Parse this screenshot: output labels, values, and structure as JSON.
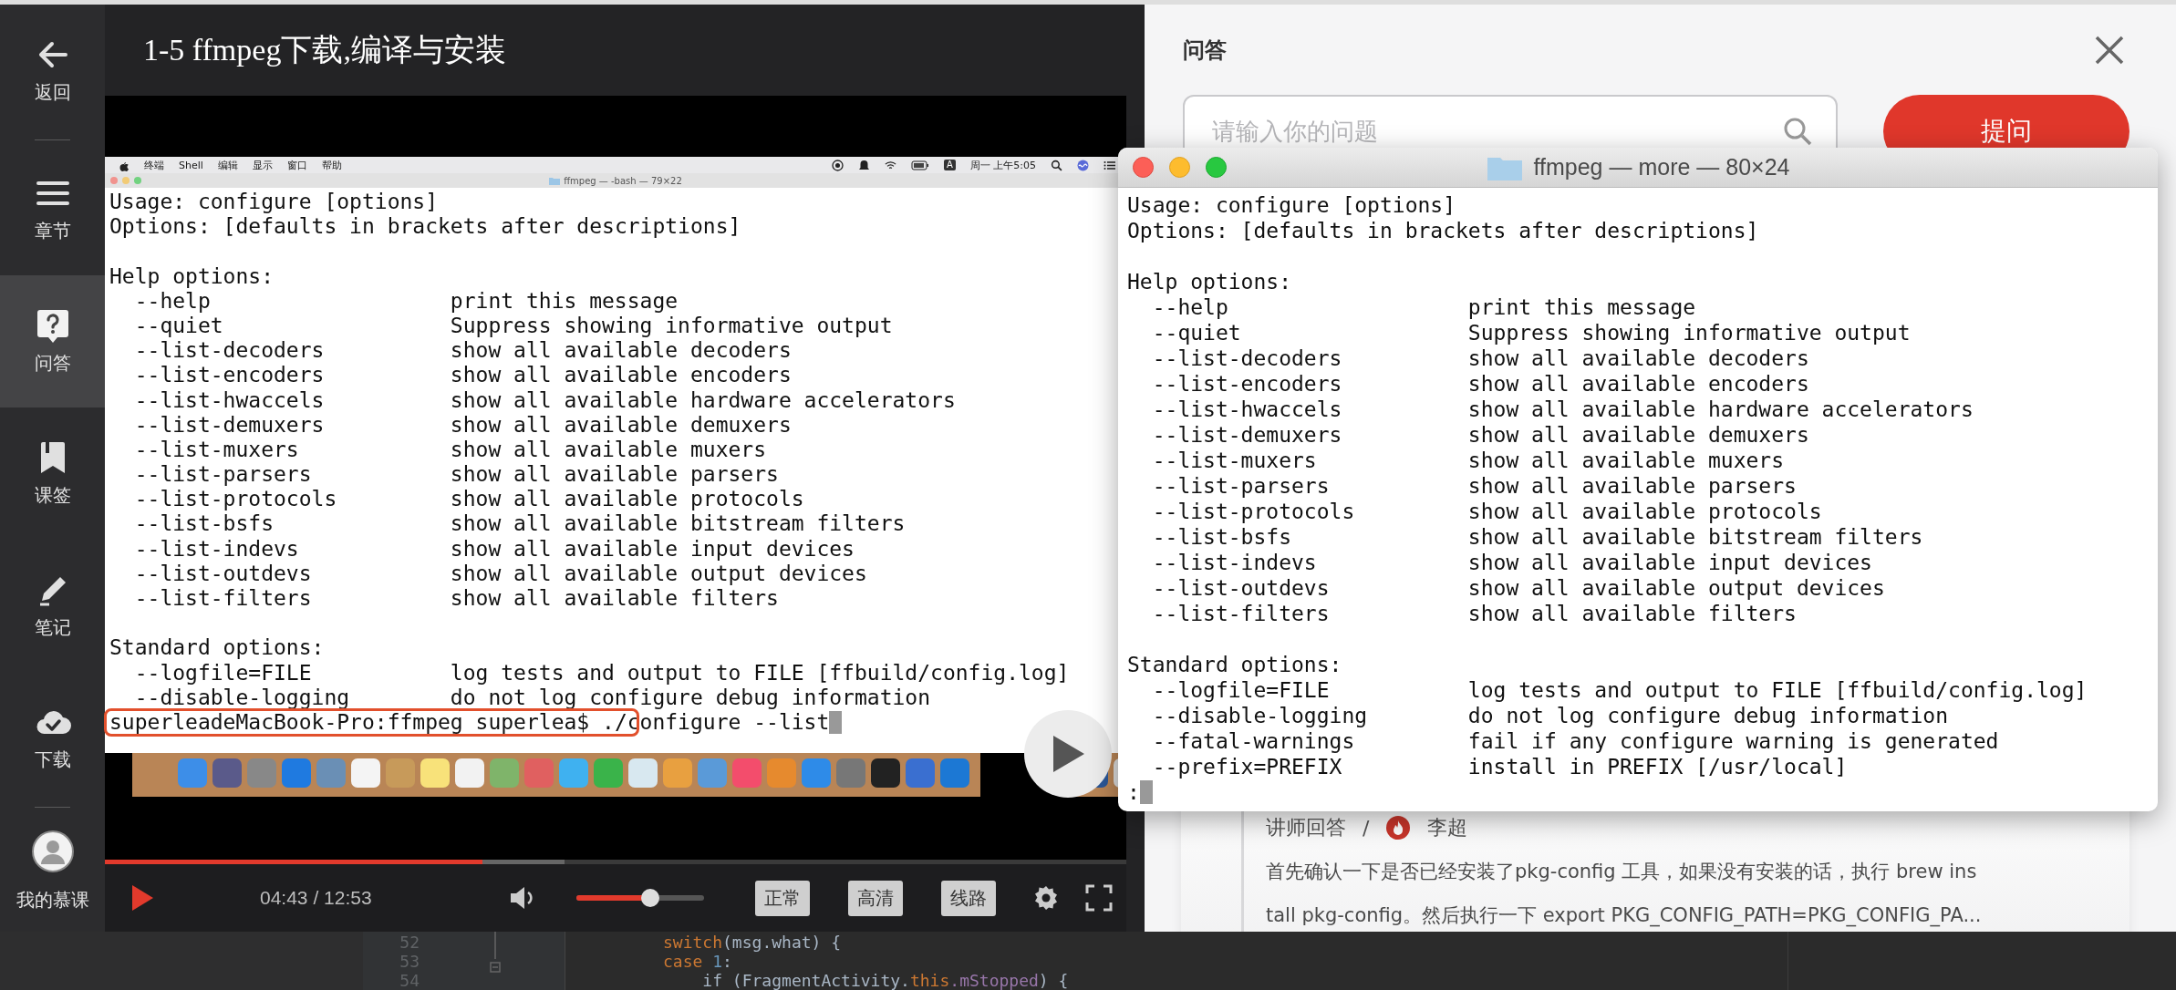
{
  "sidebar": {
    "items": [
      {
        "kind": "back",
        "label": "返回",
        "selected": false
      },
      {
        "kind": "chapters",
        "label": "章节",
        "selected": false
      },
      {
        "kind": "qa",
        "label": "问答",
        "selected": true
      },
      {
        "kind": "bookmark",
        "label": "课签",
        "selected": false
      },
      {
        "kind": "notes",
        "label": "笔记",
        "selected": false
      },
      {
        "kind": "download",
        "label": "下载",
        "selected": false
      }
    ],
    "profile": {
      "label": "我的慕课"
    }
  },
  "lesson_title": "1-5 ffmpeg下载,编译与安装",
  "video": {
    "menu_bar": {
      "items": [
        "终端",
        "Shell",
        "编辑",
        "显示",
        "窗口",
        "帮助"
      ],
      "input_source": "A",
      "clock": "周一 上午5:05"
    },
    "terminal": {
      "title": "ffmpeg — -bash — 79×22",
      "lines": [
        {
          "kind": "text",
          "text": "Usage: configure [options]"
        },
        {
          "kind": "text",
          "text": "Options: [defaults in brackets after descriptions]"
        },
        {
          "kind": "blank"
        },
        {
          "kind": "text",
          "text": "Help options:"
        },
        {
          "kind": "option",
          "option": "--help",
          "description": "print this message"
        },
        {
          "kind": "option",
          "option": "--quiet",
          "description": "Suppress showing informative output"
        },
        {
          "kind": "option",
          "option": "--list-decoders",
          "description": "show all available decoders"
        },
        {
          "kind": "option",
          "option": "--list-encoders",
          "description": "show all available encoders"
        },
        {
          "kind": "option",
          "option": "--list-hwaccels",
          "description": "show all available hardware accelerators"
        },
        {
          "kind": "option",
          "option": "--list-demuxers",
          "description": "show all available demuxers"
        },
        {
          "kind": "option",
          "option": "--list-muxers",
          "description": "show all available muxers"
        },
        {
          "kind": "option",
          "option": "--list-parsers",
          "description": "show all available parsers"
        },
        {
          "kind": "option",
          "option": "--list-protocols",
          "description": "show all available protocols"
        },
        {
          "kind": "option",
          "option": "--list-bsfs",
          "description": "show all available bitstream filters"
        },
        {
          "kind": "option",
          "option": "--list-indevs",
          "description": "show all available input devices"
        },
        {
          "kind": "option",
          "option": "--list-outdevs",
          "description": "show all available output devices"
        },
        {
          "kind": "option",
          "option": "--list-filters",
          "description": "show all available filters"
        },
        {
          "kind": "blank"
        },
        {
          "kind": "text",
          "text": "Standard options:"
        },
        {
          "kind": "option",
          "option": "--logfile=FILE",
          "description": "log tests and output to FILE [ffbuild/config.log]"
        },
        {
          "kind": "option",
          "option": "--disable-logging",
          "description": "do not log configure debug information"
        },
        {
          "kind": "prompt",
          "text": "superleadeMacBook-Pro:ffmpeg superlea$ ./configure --list",
          "highlighted": true
        }
      ]
    }
  },
  "player": {
    "progress": {
      "level": 0.37
    },
    "buffered": {
      "level": 0.45
    },
    "time": "04:43 / 12:53",
    "volume": {
      "level": 0.58
    },
    "buttons": [
      "正常",
      "高清",
      "线路"
    ]
  },
  "qa_panel": {
    "title": "问答",
    "search": {
      "placeholder": "请输入你的问题"
    },
    "ask_button": "提问",
    "answer": {
      "label": "讲师回答",
      "separator": "/",
      "author": "李超",
      "lines": [
        "首先确认一下是否已经安装了pkg-config 工具，如果没有安装的话，执行 brew ins",
        "tall pkg-config。然后执行一下 export PKG_CONFIG_PATH=PKG_CONFIG_PA..."
      ]
    }
  },
  "terminal_window": {
    "title": "ffmpeg — more — 80×24",
    "lines": [
      {
        "kind": "text",
        "text": "Usage: configure [options]"
      },
      {
        "kind": "text",
        "text": "Options: [defaults in brackets after descriptions]"
      },
      {
        "kind": "blank"
      },
      {
        "kind": "text",
        "text": "Help options:"
      },
      {
        "kind": "option",
        "option": "--help",
        "description": "print this message"
      },
      {
        "kind": "option",
        "option": "--quiet",
        "description": "Suppress showing informative output"
      },
      {
        "kind": "option",
        "option": "--list-decoders",
        "description": "show all available decoders"
      },
      {
        "kind": "option",
        "option": "--list-encoders",
        "description": "show all available encoders"
      },
      {
        "kind": "option",
        "option": "--list-hwaccels",
        "description": "show all available hardware accelerators"
      },
      {
        "kind": "option",
        "option": "--list-demuxers",
        "description": "show all available demuxers"
      },
      {
        "kind": "option",
        "option": "--list-muxers",
        "description": "show all available muxers"
      },
      {
        "kind": "option",
        "option": "--list-parsers",
        "description": "show all available parsers"
      },
      {
        "kind": "option",
        "option": "--list-protocols",
        "description": "show all available protocols"
      },
      {
        "kind": "option",
        "option": "--list-bsfs",
        "description": "show all available bitstream filters"
      },
      {
        "kind": "option",
        "option": "--list-indevs",
        "description": "show all available input devices"
      },
      {
        "kind": "option",
        "option": "--list-outdevs",
        "description": "show all available output devices"
      },
      {
        "kind": "option",
        "option": "--list-filters",
        "description": "show all available filters"
      },
      {
        "kind": "blank"
      },
      {
        "kind": "text",
        "text": "Standard options:"
      },
      {
        "kind": "option",
        "option": "--logfile=FILE",
        "description": "log tests and output to FILE [ffbuild/config.log]"
      },
      {
        "kind": "option",
        "option": "--disable-logging",
        "description": "do not log configure debug information"
      },
      {
        "kind": "option",
        "option": "--fatal-warnings",
        "description": "fail if any configure warning is generated"
      },
      {
        "kind": "option",
        "option": "--prefix=PREFIX",
        "description": "install in PREFIX [/usr/local]"
      },
      {
        "kind": "prompt",
        "text": ":",
        "highlighted": false
      }
    ]
  },
  "code_editor": {
    "lines": [
      {
        "number": "52",
        "tokens": [
          {
            "kind": "keyword",
            "text": "switch"
          },
          {
            "kind": "plain",
            "text": "(msg.what) {"
          }
        ]
      },
      {
        "number": "53",
        "tokens": [
          {
            "kind": "keyword",
            "text": "case "
          },
          {
            "kind": "number",
            "text": "1"
          },
          {
            "kind": "plain",
            "text": ":"
          }
        ]
      },
      {
        "number": "54",
        "tokens": [
          {
            "kind": "plain",
            "text": "    if (FragmentActivity."
          },
          {
            "kind": "keyword",
            "text": "this"
          },
          {
            "kind": "field",
            "text": ".mStopped"
          },
          {
            "kind": "plain",
            "text": ") {"
          }
        ]
      }
    ]
  }
}
